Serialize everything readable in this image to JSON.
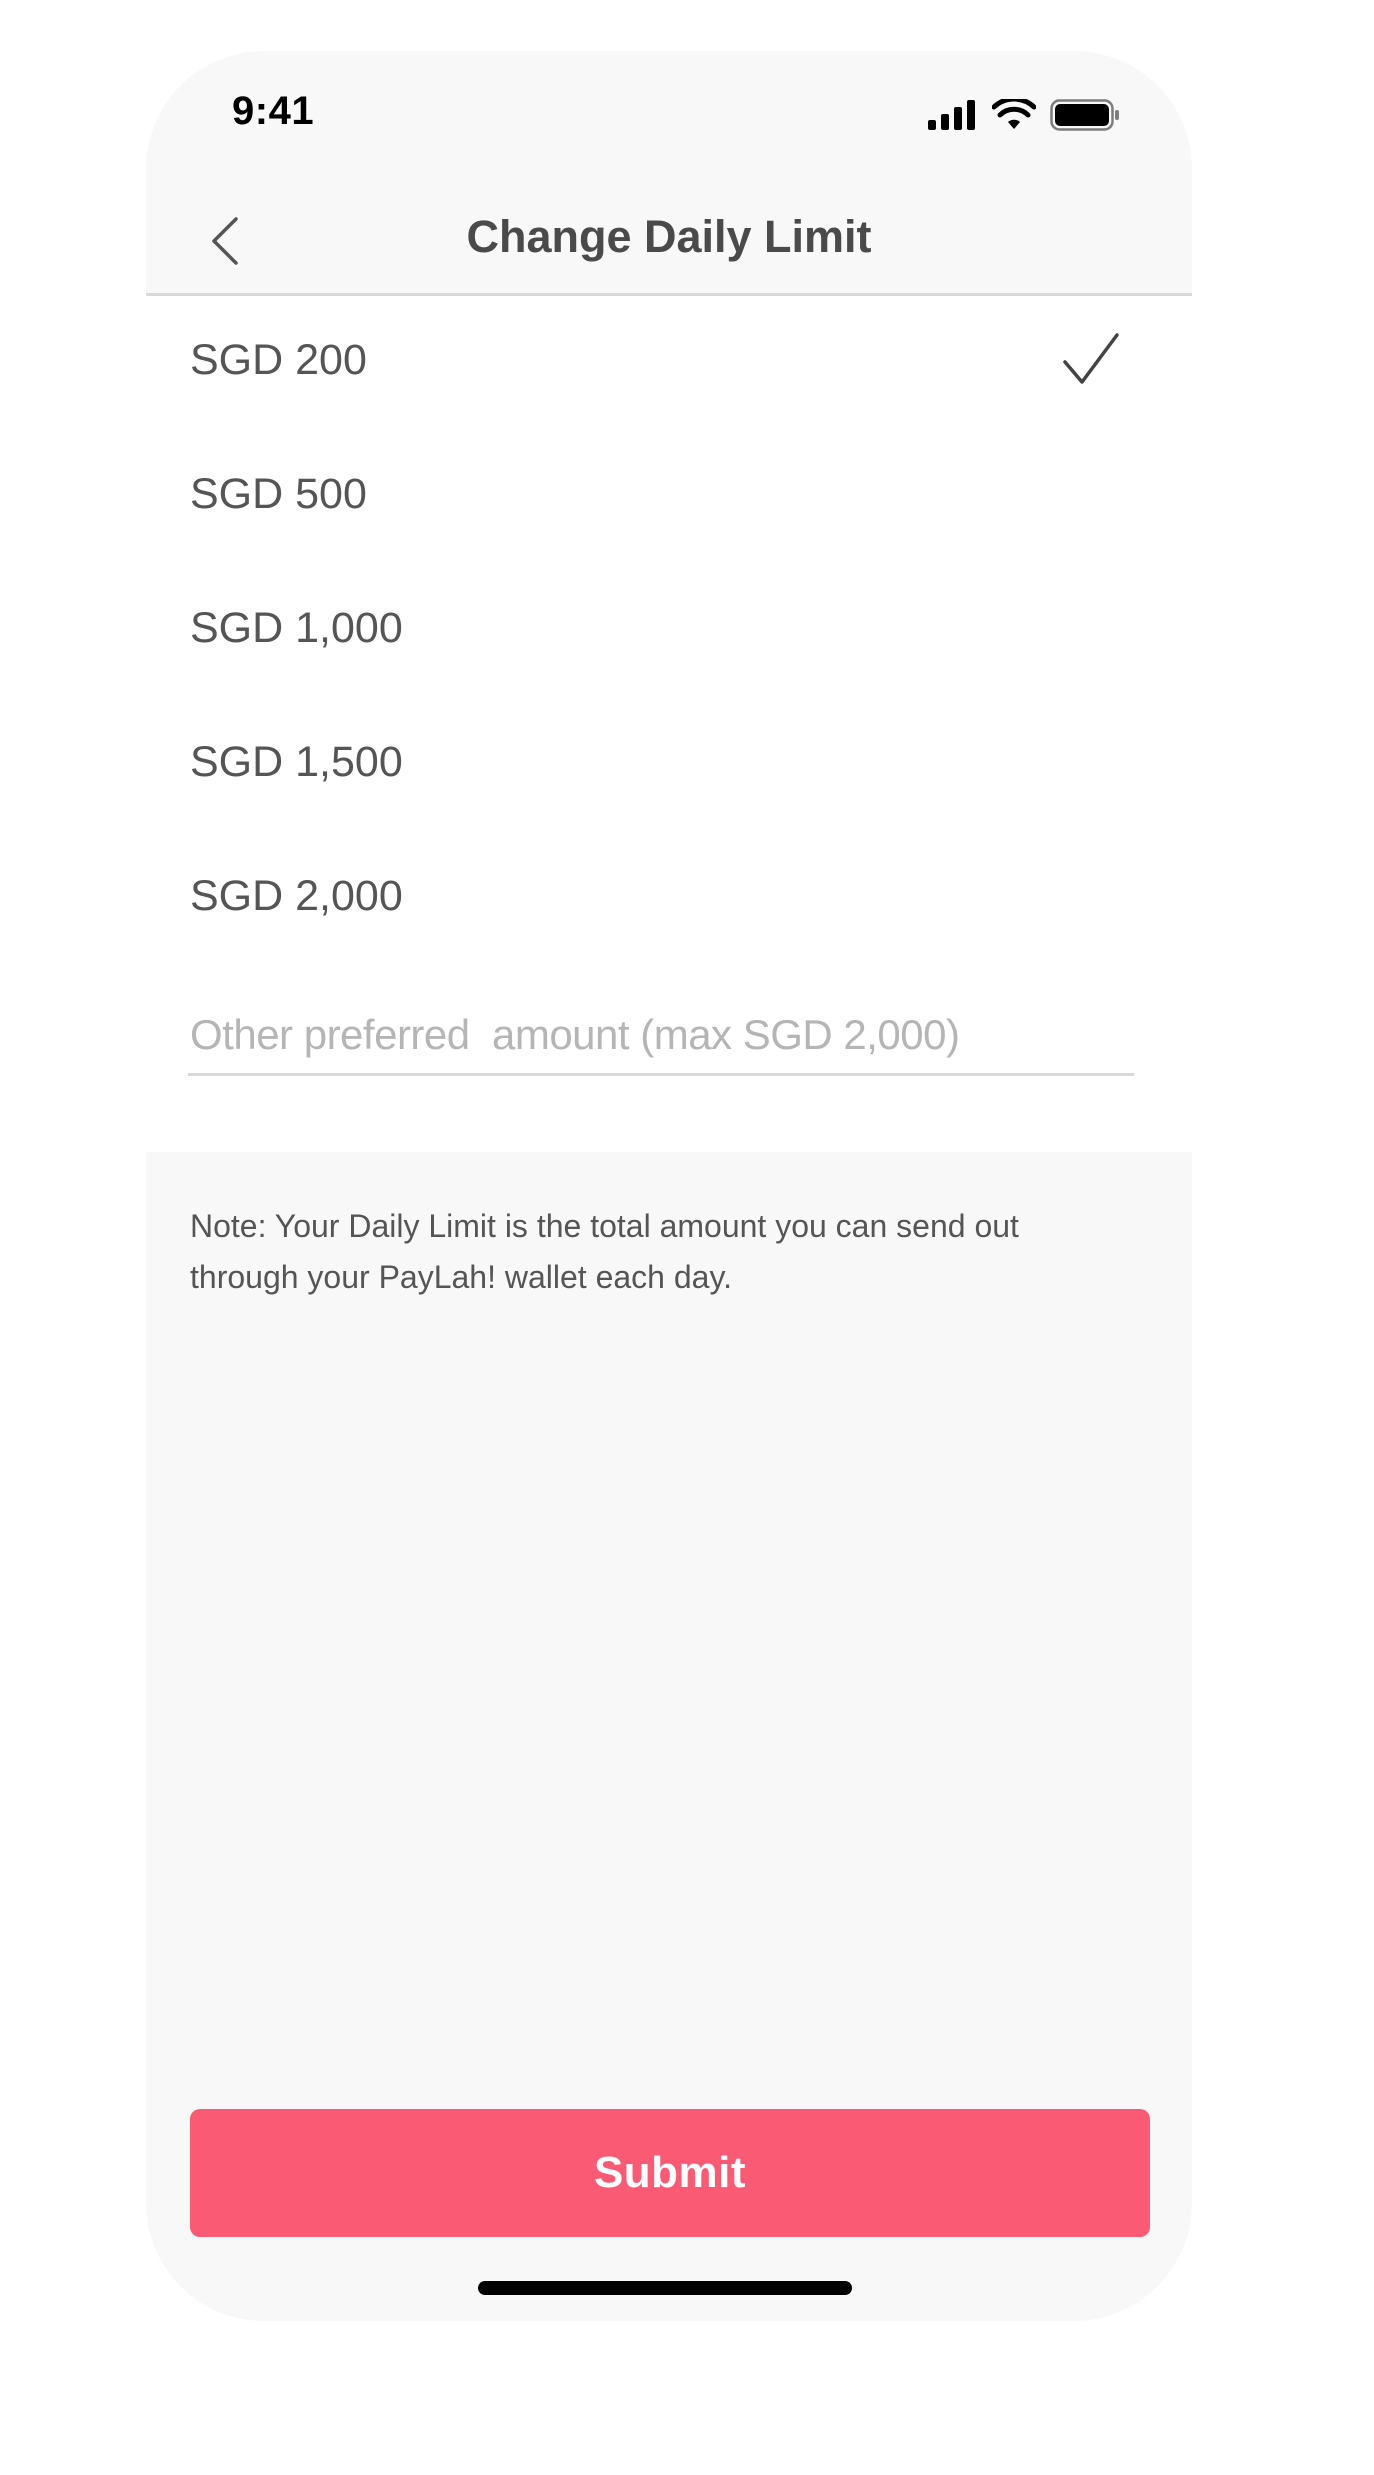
{
  "status_bar": {
    "time": "9:41",
    "icons": [
      "cellular-signal-icon",
      "wifi-icon",
      "battery-icon"
    ]
  },
  "nav": {
    "title": "Change Daily Limit",
    "back_icon": "chevron-left-icon"
  },
  "options": [
    {
      "label": "SGD 200",
      "selected": true
    },
    {
      "label": "SGD 500",
      "selected": false
    },
    {
      "label": "SGD 1,000",
      "selected": false
    },
    {
      "label": "SGD 1,500",
      "selected": false
    },
    {
      "label": "SGD 2,000",
      "selected": false
    }
  ],
  "other_amount": {
    "placeholder": "Other preferred  amount (max SGD 2,000)",
    "value": ""
  },
  "note": "Note: Your Daily Limit is the total amount you can send out through your PayLah! wallet each day.",
  "submit_label": "Submit",
  "colors": {
    "accent": "#fb5a75",
    "background": "#f8f8f8",
    "text": "#555555",
    "placeholder": "#b5b5b5"
  }
}
